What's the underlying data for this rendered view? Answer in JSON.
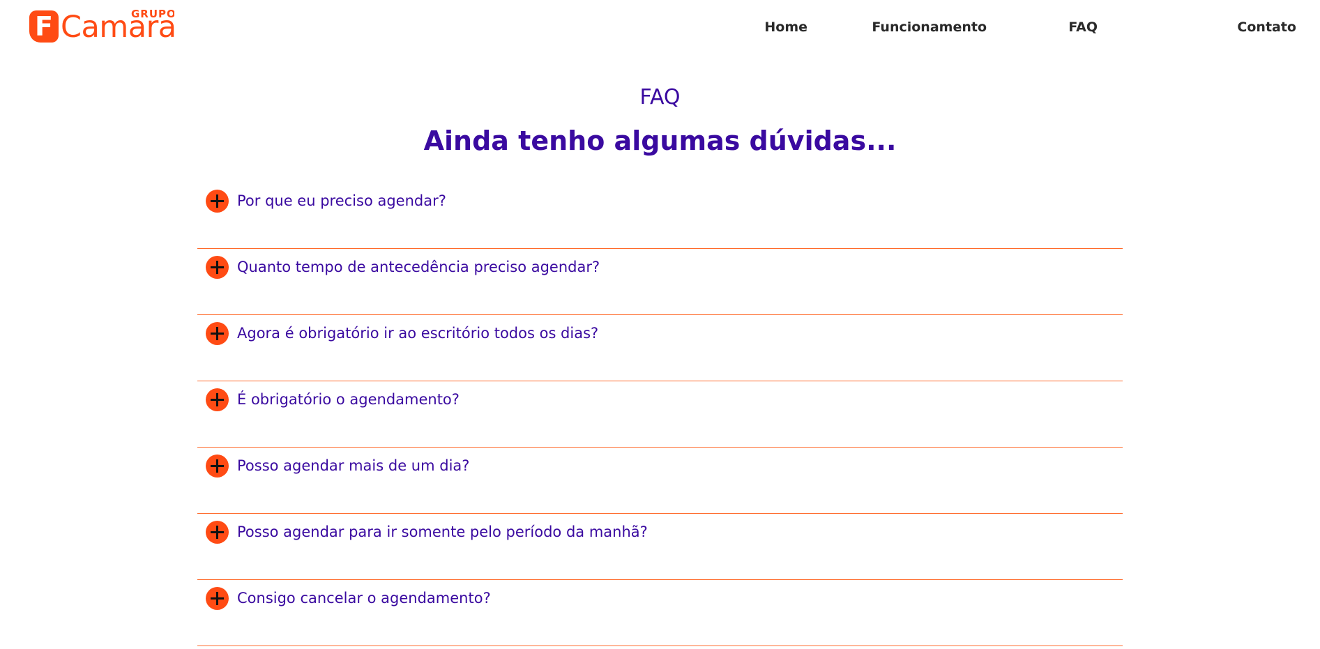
{
  "brand": {
    "logo_letter": "F",
    "logo_wordmark": "Camara",
    "logo_group": "GRUPO",
    "accent_color": "#ff4b14",
    "primary_color": "#3a0aa0"
  },
  "nav": {
    "items": [
      {
        "label": "Home"
      },
      {
        "label": "Funcionamento"
      },
      {
        "label": "FAQ"
      },
      {
        "label": "Contato"
      }
    ]
  },
  "faq_section": {
    "eyebrow": "FAQ",
    "title": "Ainda tenho algumas dúvidas...",
    "items": [
      {
        "question": "Por que eu preciso agendar?",
        "icon": "plus-icon"
      },
      {
        "question": "Quanto tempo de antecedência preciso agendar?",
        "icon": "plus-icon"
      },
      {
        "question": "Agora é obrigatório ir ao escritório todos os dias?",
        "icon": "plus-icon"
      },
      {
        "question": "É obrigatório o agendamento?",
        "icon": "plus-icon"
      },
      {
        "question": "Posso agendar mais de um dia?",
        "icon": "plus-icon"
      },
      {
        "question": "Posso agendar para ir somente pelo período da manhã?",
        "icon": "plus-icon"
      },
      {
        "question": "Consigo cancelar o agendamento?",
        "icon": "plus-icon"
      }
    ]
  }
}
